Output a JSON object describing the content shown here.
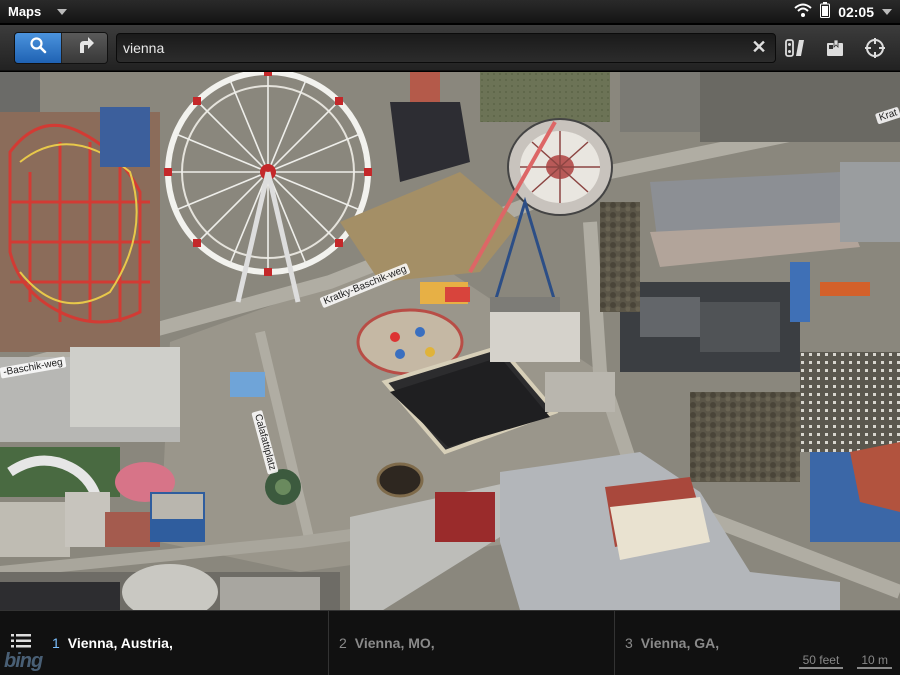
{
  "status_bar": {
    "app_name": "Maps",
    "time": "02:05"
  },
  "toolbar": {
    "search_value": "vienna",
    "clear_label": "✕"
  },
  "map": {
    "labels": {
      "street_1": "Kratky-Baschik-weg",
      "street_2": "-Baschik-weg",
      "street_3": "Calafattiplatz",
      "street_4": "Krat"
    }
  },
  "results": [
    {
      "number": "1",
      "label": "Vienna, Austria,"
    },
    {
      "number": "2",
      "label": "Vienna, MO,"
    },
    {
      "number": "3",
      "label": "Vienna, GA,"
    }
  ],
  "attribution": "bing",
  "scale": {
    "feet": "50 feet",
    "meters": "10 m"
  },
  "colors": {
    "accent": "#2f7bd0",
    "statusbar": "#1e1e1e",
    "results_bg": "#121212"
  }
}
